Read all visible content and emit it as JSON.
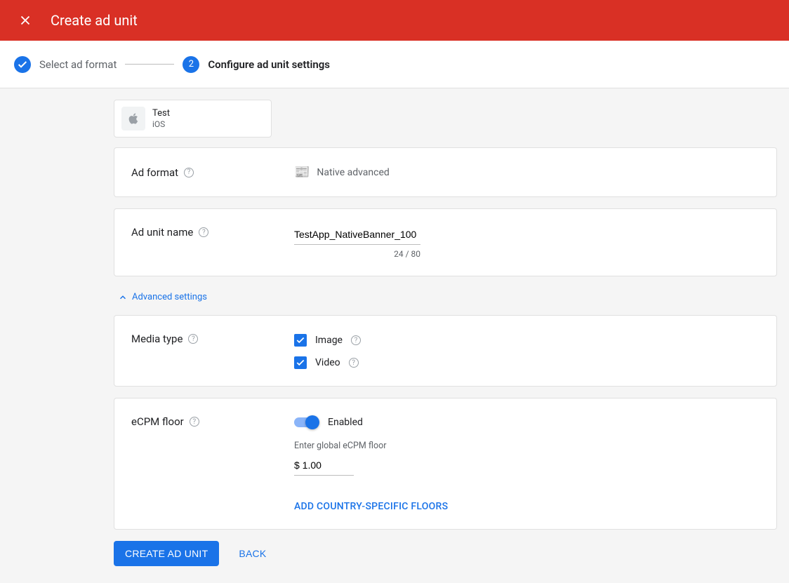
{
  "header": {
    "title": "Create ad unit"
  },
  "stepper": {
    "step1_label": "Select ad format",
    "step2_number": "2",
    "step2_label": "Configure ad unit settings"
  },
  "app": {
    "name": "Test",
    "platform": "iOS"
  },
  "ad_format": {
    "label": "Ad format",
    "value": "Native advanced"
  },
  "ad_unit_name": {
    "label": "Ad unit name",
    "value": "TestApp_NativeBanner_100",
    "char_count": "24 / 80"
  },
  "advanced_link": "Advanced settings",
  "media_type": {
    "label": "Media type",
    "image_label": "Image",
    "video_label": "Video"
  },
  "ecpm": {
    "label": "eCPM floor",
    "toggle_label": "Enabled",
    "hint": "Enter global eCPM floor",
    "value": "$ 1.00",
    "add_btn": "Add country-specific floors"
  },
  "footer": {
    "create": "Create ad unit",
    "back": "Back"
  }
}
